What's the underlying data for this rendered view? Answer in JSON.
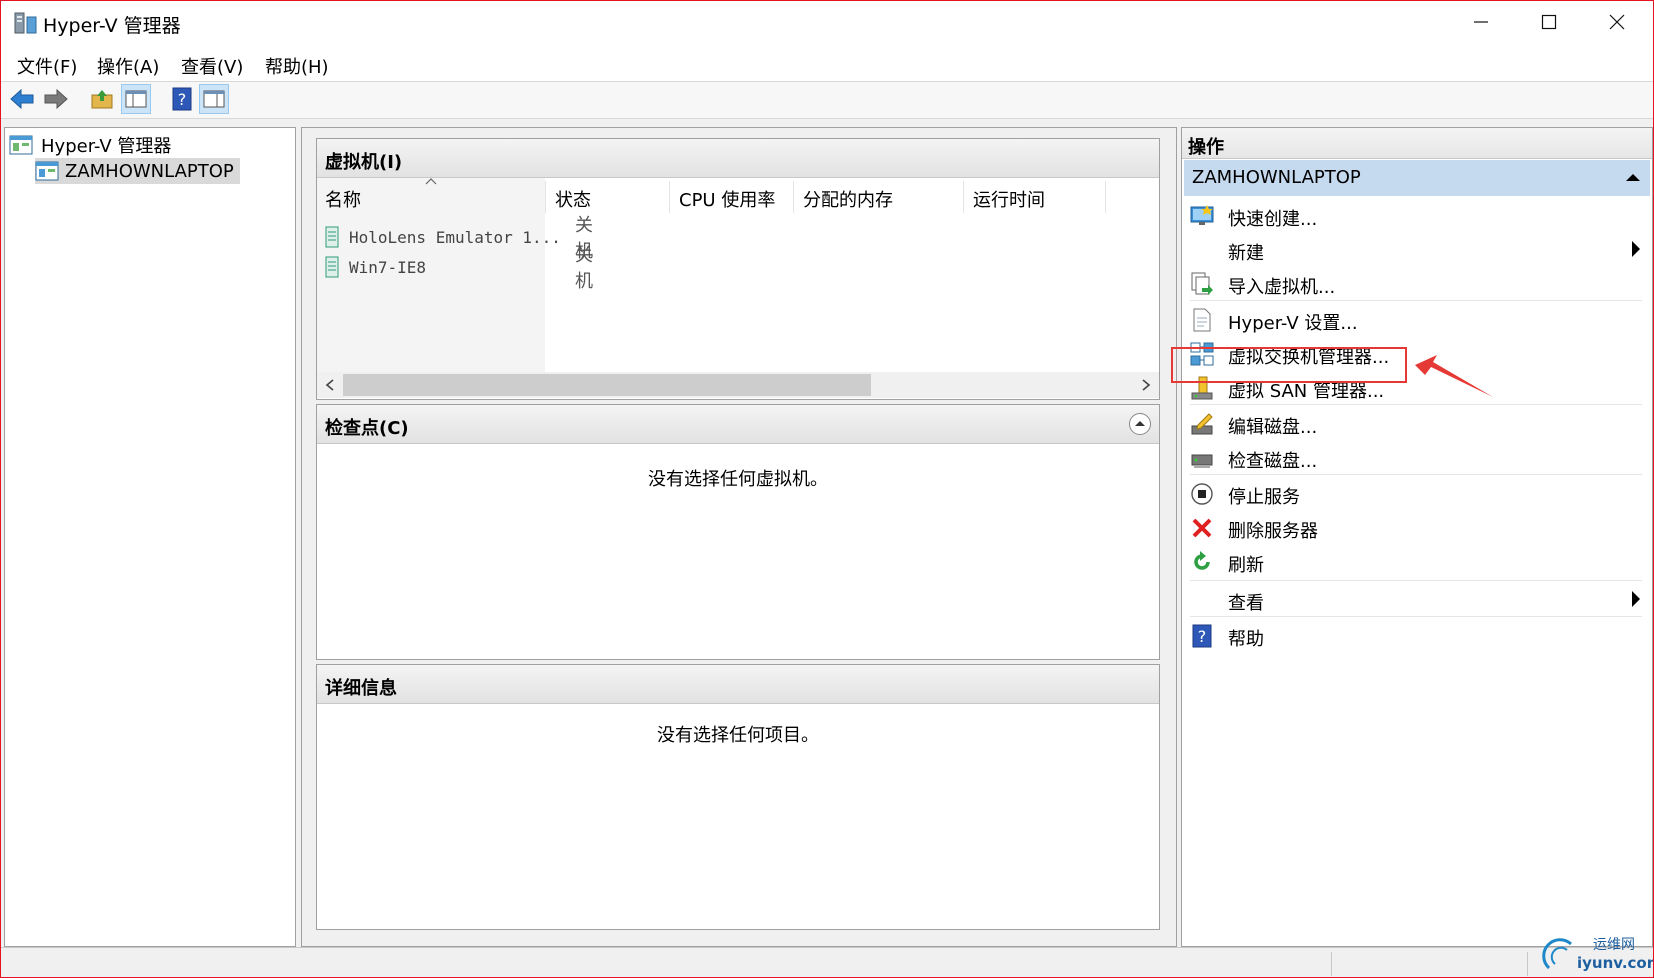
{
  "window": {
    "title": "Hyper-V 管理器",
    "minimize_icon": "minimize-icon",
    "maximize_icon": "maximize-icon",
    "close_icon": "close-icon"
  },
  "menu": [
    "文件(F)",
    "操作(A)",
    "查看(V)",
    "帮助(H)"
  ],
  "toolbar": {
    "icons": [
      "back-arrow-icon",
      "forward-arrow-icon",
      "up-folder-icon",
      "show-hide-tree-icon",
      "help-icon",
      "show-hide-action-pane-icon"
    ]
  },
  "tree": {
    "root": "Hyper-V 管理器",
    "server": "ZAMHOWNLAPTOP"
  },
  "vm_panel": {
    "title": "虚拟机(I)",
    "columns": [
      "名称",
      "状态",
      "CPU 使用率",
      "分配的内存",
      "运行时间"
    ],
    "rows": [
      {
        "name": "HoloLens Emulator 1...",
        "state": "关机"
      },
      {
        "name": "Win7-IE8",
        "state": "关机"
      }
    ]
  },
  "checkpoint_panel": {
    "title": "检查点(C)",
    "message": "没有选择任何虚拟机。"
  },
  "details_panel": {
    "title": "详细信息",
    "message": "没有选择任何项目。"
  },
  "actions": {
    "title": "操作",
    "group": "ZAMHOWNLAPTOP",
    "items": [
      {
        "label": "快速创建...",
        "icon": "quick-create-icon"
      },
      {
        "label": "新建",
        "icon": "",
        "submenu": true
      },
      {
        "label": "导入虚拟机...",
        "icon": "import-vm-icon"
      },
      {
        "label": "Hyper-V 设置...",
        "icon": "settings-doc-icon"
      },
      {
        "label": "虚拟交换机管理器...",
        "icon": "virtual-switch-icon",
        "highlighted": true
      },
      {
        "label": "虚拟 SAN 管理器...",
        "icon": "san-manager-icon"
      },
      {
        "label": "编辑磁盘...",
        "icon": "edit-disk-icon"
      },
      {
        "label": "检查磁盘...",
        "icon": "inspect-disk-icon"
      },
      {
        "label": "停止服务",
        "icon": "stop-service-icon"
      },
      {
        "label": "删除服务器",
        "icon": "delete-icon"
      },
      {
        "label": "刷新",
        "icon": "refresh-icon"
      },
      {
        "label": "查看",
        "icon": "",
        "submenu": true
      },
      {
        "label": "帮助",
        "icon": "help-icon"
      }
    ]
  },
  "watermark": {
    "line1": "运维网",
    "line2": "iyunv.com"
  },
  "colors": {
    "highlight_box": "#e53935",
    "action_group_bg": "#c5d9ef",
    "window_border": "#e81123"
  }
}
